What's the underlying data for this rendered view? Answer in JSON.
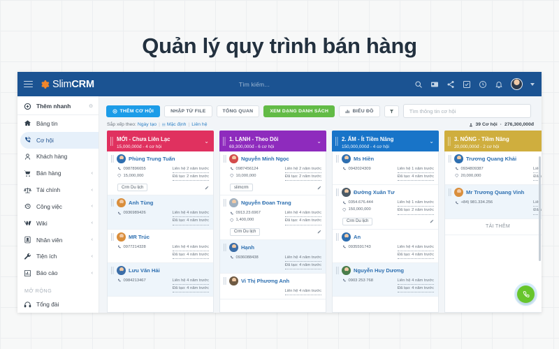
{
  "hero": {
    "title": "Quản lý quy trình bán hàng"
  },
  "topbar": {
    "brand_thin": "Slim",
    "brand_bold": "CRM",
    "search_placeholder": "Tìm kiếm...",
    "icons": [
      "search-icon",
      "card-icon",
      "share-icon",
      "task-icon",
      "clock-icon",
      "bell-icon"
    ]
  },
  "sidebar": {
    "quick": {
      "label": "Thêm nhanh"
    },
    "items": [
      {
        "label": "Bảng tin",
        "icon": "home-icon",
        "chevron": false,
        "active": false
      },
      {
        "label": "Cơ hội",
        "icon": "phone-icon",
        "chevron": false,
        "active": true
      },
      {
        "label": "Khách hàng",
        "icon": "user-icon",
        "chevron": false,
        "active": false
      },
      {
        "label": "Bán hàng",
        "icon": "cart-icon",
        "chevron": true,
        "active": false
      },
      {
        "label": "Tài chính",
        "icon": "scales-icon",
        "chevron": true,
        "active": false
      },
      {
        "label": "Công việc",
        "icon": "clock-icon",
        "chevron": true,
        "active": false
      },
      {
        "label": "Wiki",
        "icon": "wiki-icon",
        "chevron": true,
        "active": false
      },
      {
        "label": "Nhân viên",
        "icon": "badge-icon",
        "chevron": true,
        "active": false
      },
      {
        "label": "Tiện ích",
        "icon": "wrench-icon",
        "chevron": true,
        "active": false
      },
      {
        "label": "Báo cáo",
        "icon": "chart-icon",
        "chevron": true,
        "active": false
      }
    ],
    "section_label": "MỞ RỘNG",
    "extra_items": [
      {
        "label": "Tổng đài",
        "icon": "headset-icon",
        "chevron": false,
        "active": false
      }
    ]
  },
  "toolbar": {
    "add_label": "THÊM CƠ HỘI",
    "import_label": "NHẬP TỪ FILE",
    "overview_label": "TỔNG QUAN",
    "list_label": "XEM DẠNG DANH SÁCH",
    "chart_label": "BIỂU ĐỒ",
    "filter_icon": "filter-icon",
    "search_placeholder": "Tìm thông tin cơ hội"
  },
  "sortrow": {
    "prefix": "Sắp xếp theo:",
    "opt1": "Ngày tạo",
    "opt2": "Mặc định",
    "opt3": "Liên hệ",
    "count": "39 Cơ hội",
    "dot": "·",
    "total": "276,300,000đ"
  },
  "board": {
    "columns": [
      {
        "title": "MỚI - Chưa Liên Lạc",
        "subtitle": "15,000,000đ - 4 cơ hội",
        "color": "#e0315f",
        "load_more": null,
        "cards": [
          {
            "name": "Phùng Trung Tuấn",
            "phone": "0987896655",
            "amount": "15,000,000",
            "contact": "Liên hệ 2 năm trước",
            "created": "Đã tạo: 2 năm trước",
            "tag": "Crm Du lịch",
            "alt": false,
            "avatar": "#2f6fb0"
          },
          {
            "name": "Anh Tùng",
            "phone": "0936989426",
            "amount": null,
            "contact": "Liên hệ 4 năm trước",
            "created": "Đã tạo: 4 năm trước",
            "tag": null,
            "alt": true,
            "avatar": "#d98e3c"
          },
          {
            "name": "MR Trúc",
            "phone": "0977214328",
            "amount": null,
            "contact": "Liên hệ 4 năm trước",
            "created": "Đã tạo: 4 năm trước",
            "tag": null,
            "alt": false,
            "avatar": "#d98e3c"
          },
          {
            "name": "Lưu Văn Hải",
            "phone": "0984213467",
            "amount": null,
            "contact": "Liên hệ 4 năm trước",
            "created": "Đã tạo: 4 năm trước",
            "tag": null,
            "alt": true,
            "avatar": "#3b6ea8"
          }
        ]
      },
      {
        "title": "1. LẠNH - Theo Dõi",
        "subtitle": "69,300,000đ - 6 cơ hội",
        "color": "#8e2bbd",
        "load_more": null,
        "cards": [
          {
            "name": "Nguyễn Minh Ngọc",
            "phone": "0987456124",
            "amount": "10,000,000",
            "contact": "Liên hệ 2 năm trước",
            "created": "Đã tạo: 2 năm trước",
            "tag": "slimcrm",
            "alt": false,
            "avatar": "#d34b4b"
          },
          {
            "name": "Nguyễn Đoan Trang",
            "phone": "0913.23.6967",
            "amount": "1,400,000",
            "contact": "Liên hệ 4 năm trước",
            "created": "Đã tạo: 4 năm trước",
            "tag": "Crm Du lịch",
            "alt": false,
            "avatar": "#9fb0c0"
          },
          {
            "name": "Hạnh",
            "phone": "0936088438",
            "amount": null,
            "contact": "Liên hệ 4 năm trước",
            "created": "Đã tạo: 4 năm trước",
            "tag": null,
            "alt": true,
            "avatar": "#3b6ea8"
          },
          {
            "name": "Vi Thị Phương Anh",
            "phone": null,
            "amount": null,
            "contact": "Liên hệ 4 năm trước",
            "created": null,
            "tag": null,
            "alt": false,
            "avatar": "#6f5a43"
          }
        ]
      },
      {
        "title": "2. ẤM - Ít Tiềm Năng",
        "subtitle": "150,000,000đ - 4 cơ hội",
        "color": "#1874c8",
        "load_more": null,
        "cards": [
          {
            "name": "Ms Hiền",
            "phone": "0942024309",
            "amount": null,
            "contact": "Liên hệ 1 năm trước",
            "created": "Đã tạo: 4 năm trước",
            "tag": null,
            "alt": false,
            "avatar": "#2f6fb0"
          },
          {
            "name": "Đường Xuân Tư",
            "phone": "0354.676.444",
            "amount": "150,000,000",
            "contact": "Liên hệ 1 năm trước",
            "created": "Đã tạo: 2 năm trước",
            "tag": "Crm Du lịch",
            "alt": false,
            "avatar": "#4c5a66"
          },
          {
            "name": "An",
            "phone": "0935591743",
            "amount": null,
            "contact": "Liên hệ 4 năm trước",
            "created": "Đã tạo: 4 năm trước",
            "tag": null,
            "alt": false,
            "avatar": "#2f6fb0"
          },
          {
            "name": "Nguyễn Huy Dương",
            "phone": "0903 253 768",
            "amount": null,
            "contact": "Liên hệ 4 năm trước",
            "created": "Đã tạo: 4 năm trước",
            "tag": null,
            "alt": true,
            "avatar": "#4a7d4a"
          }
        ]
      },
      {
        "title": "3. NÓNG - Tiềm Năng",
        "subtitle": "20,000,000đ - 2 cơ hội",
        "color": "#cfae3e",
        "load_more": "TẢI THÊM",
        "cards": [
          {
            "name": "Trương Quang Khải",
            "phone": "0934809387",
            "amount": "20,000,000",
            "contact": "Liên hệ",
            "created": "Đã tạo:",
            "tag": null,
            "alt": false,
            "avatar": "#2f6fb0"
          },
          {
            "name": "Mr Trương Quang Vinh",
            "phone": "+84) 981.334.256",
            "amount": null,
            "contact": "Liên hệ",
            "created": "Đã tạo:",
            "tag": null,
            "alt": true,
            "avatar": "#d98e3c"
          }
        ]
      }
    ]
  },
  "fab": {
    "icon": "phone-call-icon"
  }
}
